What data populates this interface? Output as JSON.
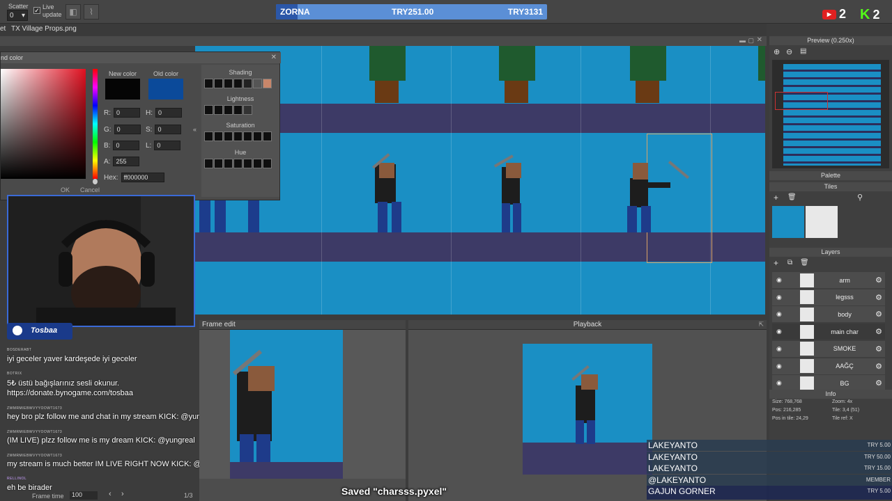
{
  "toolbar": {
    "scatter_label": "Scatter",
    "scatter_value": "0",
    "live_update_line1": "Live",
    "live_update_line2": "update"
  },
  "donation_bar": {
    "name": "ZORNA",
    "amount": "TRY251.00",
    "goal": "TRY3131",
    "progress": 0.08
  },
  "social": {
    "youtube_count": "2",
    "kick_count": "2"
  },
  "tabs": {
    "tab_prefix": "et",
    "tab_file": "TX Village Props.png"
  },
  "color_dialog": {
    "title": "nd color",
    "new_color_label": "New color",
    "old_color_label": "Old color",
    "new_color": "#050505",
    "old_color": "#0b4a9a",
    "r_label": "R:",
    "r_value": "0",
    "g_label": "G:",
    "g_value": "0",
    "b_label": "B:",
    "b_value": "0",
    "h_label": "H:",
    "h_value": "0",
    "s_label": "S:",
    "s_value": "0",
    "l_label": "L:",
    "l_value": "0",
    "a_label": "A:",
    "a_value": "255",
    "hex_label": "Hex:",
    "hex_value": "ff000000",
    "shading_label": "Shading",
    "lightness_label": "Lightness",
    "saturation_label": "Saturation",
    "hue_label": "Hue",
    "ok_label": "OK",
    "cancel_label": "Cancel"
  },
  "chat": {
    "streamer": "Tosbaa",
    "messages": [
      {
        "user": "BOSDERABT",
        "text": "iyi geceler yaver kardeşede iyi geceler"
      },
      {
        "user": "BOTRIX",
        "text": "5₺ üstü bağışlarınız sesli okunur."
      },
      {
        "user": "",
        "text": "https://donate.bynogame.com/tosbaa"
      },
      {
        "user": "ZWMRMIEBWVYYOOWT1673",
        "text": "hey bro plz follow me and chat in my stream KICK: @yungreal"
      },
      {
        "user": "ZWMRMIEBWVYYOOWT1673",
        "text": "(IM LIVE) plzz follow me is my dream KICK: @yungreal"
      },
      {
        "user": "ZWMRMIEBWVYYOOWT1673",
        "text": "my stream is much better IM LIVE RIGHT NOW KICK: @yungreal"
      },
      {
        "user": "RELLINOL",
        "text": "eh be birader"
      }
    ]
  },
  "frame_edit": {
    "title": "Frame edit",
    "frame_time_label": "Frame time",
    "frame_time_value": "100",
    "frame_counter": "1/3"
  },
  "playback": {
    "title": "Playback"
  },
  "right_panel": {
    "preview_title": "Preview (0.250x)",
    "palette_title": "Palette",
    "tiles_title": "Tiles",
    "layers_title": "Layers",
    "info_title": "Info",
    "layers": [
      {
        "name": "arm",
        "selected": false
      },
      {
        "name": "legsss",
        "selected": false
      },
      {
        "name": "body",
        "selected": false
      },
      {
        "name": "main char",
        "selected": true
      },
      {
        "name": "SMOKE",
        "selected": false
      },
      {
        "name": "AAĞÇ",
        "selected": false
      },
      {
        "name": "BG",
        "selected": false
      }
    ],
    "info": {
      "size": "Size: 768,768",
      "zoom": "Zoom: 4x",
      "pos": "Pos: 216,285",
      "tile": "Tile: 3,4 (51)",
      "pos_in_tile": "Pos in tile: 24,29",
      "tile_ref": "Tile ref: X"
    }
  },
  "donors": [
    {
      "name": "LAKEYANTO",
      "amount": "TRY 5.00"
    },
    {
      "name": "LAKEYANTO",
      "amount": "TRY 50.00"
    },
    {
      "name": "LAKEYANTO",
      "amount": "TRY 15.00"
    },
    {
      "name": "@LAKEYANTO",
      "amount": "MEMBER"
    },
    {
      "name": "GAJUN GORNER",
      "amount": "TRY 5.00"
    }
  ],
  "status_message": "Saved \"charsss.pyxel\""
}
